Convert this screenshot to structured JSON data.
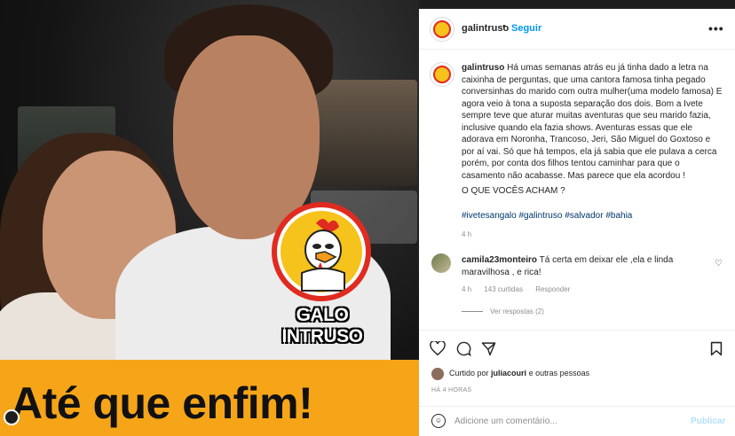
{
  "image": {
    "logo_text": "GALO INTRUSO",
    "banner_text": "Até que enfim!",
    "banner_color": "#f6a519"
  },
  "header": {
    "username": "galintruso",
    "separator": "•",
    "follow_label": "Seguir",
    "more_icon": "more-horizontal-icon"
  },
  "caption": {
    "username": "galintruso",
    "text": "Há umas semanas atrás eu já tinha dado a letra na caixinha de perguntas, que uma cantora famosa tinha pegado conversinhas do marido com outra mulher(uma modelo famosa) E agora veio à tona a suposta separação dos dois. Bom a Ivete sempre teve que aturar muitas aventuras que seu marido fazia, inclusive quando ela fazia shows. Aventuras essas que ele adorava em Noronha, Trancoso, Jeri, São Miguel do Goxtoso e por aí vai. Só que há tempos, ela já sabia que ele pulava a cerca porém, por conta dos filhos tentou caminhar para que o casamento não acabasse. Mas parece que ela acordou !",
    "question": "O QUE VOCÊS ACHAM ?",
    "hashtags": "#ivetesangalo #galintruso #salvador #bahia",
    "time": "4 h"
  },
  "comment": {
    "username": "camila23monteiro",
    "text": "Tá certa em deixar ele ,ela e linda maravilhosa , e rica!",
    "time": "4 h",
    "likes": "143 curtidas",
    "reply_label": "Responder",
    "view_replies": "Ver respostas (2)"
  },
  "actions": {
    "liked_prefix": "Curtido por",
    "liked_user": "juliacouri",
    "liked_suffix": "e outras pessoas",
    "post_time": "HÁ 4 HORAS"
  },
  "add_comment": {
    "placeholder": "Adicione um comentário...",
    "publish_label": "Publicar"
  },
  "colors": {
    "link_blue": "#0095f6",
    "hashtag": "#00376b",
    "muted": "#8e8e8e",
    "publish_disabled": "#b2dffc"
  }
}
